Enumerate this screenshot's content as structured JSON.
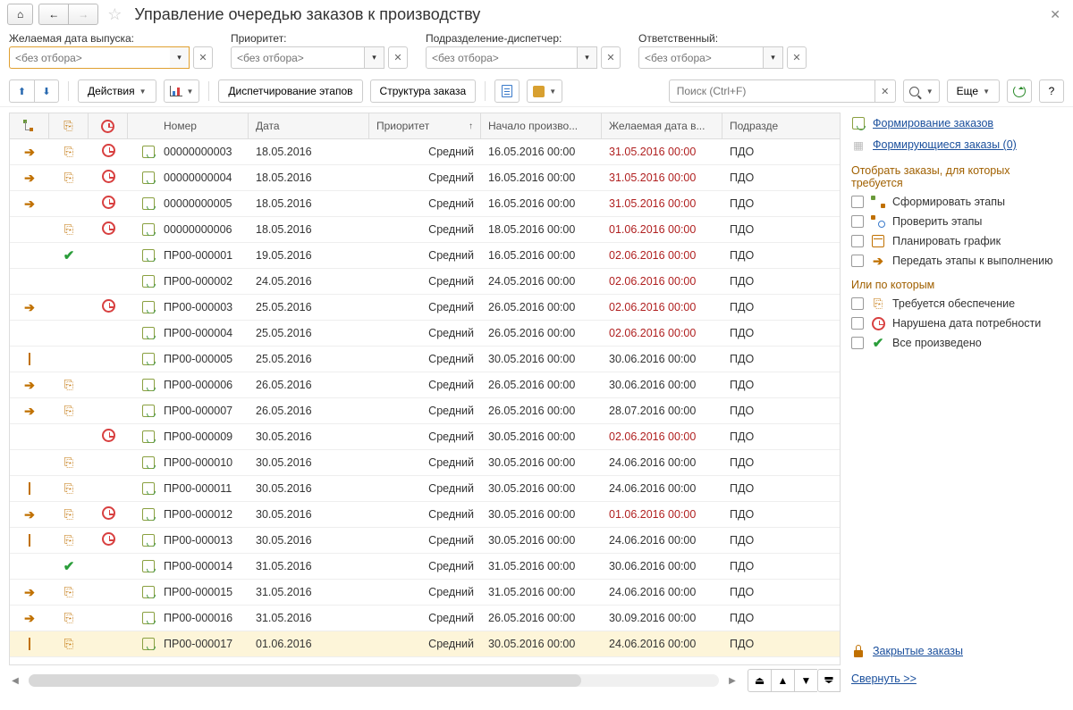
{
  "title": "Управление очередью заказов к производству",
  "filters": {
    "release_date": {
      "label": "Желаемая дата выпуска:",
      "placeholder": "<без отбора>"
    },
    "priority": {
      "label": "Приоритет:",
      "placeholder": "<без отбора>"
    },
    "dispatcher": {
      "label": "Подразделение-диспетчер:",
      "placeholder": "<без отбора>"
    },
    "responsible": {
      "label": "Ответственный:",
      "placeholder": "<без отбора>"
    }
  },
  "toolbar": {
    "actions": "Действия",
    "dispatching": "Диспетчирование этапов",
    "structure": "Структура заказа",
    "search_placeholder": "Поиск (Ctrl+F)",
    "more": "Еще"
  },
  "columns": {
    "number": "Номер",
    "date": "Дата",
    "priority": "Приоритет",
    "sort_arrow": "↑",
    "start": "Начало произво...",
    "want": "Желаемая дата в...",
    "dept": "Подразде"
  },
  "rows": [
    {
      "ic1": "arrow",
      "ic2": "box",
      "ic3": "clock",
      "number": "00000000003",
      "date": "18.05.2016",
      "priority": "Средний",
      "start": "16.05.2016 00:00",
      "want": "31.05.2016 00:00",
      "red": true,
      "dept": "ПДО"
    },
    {
      "ic1": "arrow",
      "ic2": "box",
      "ic3": "clock",
      "number": "00000000004",
      "date": "18.05.2016",
      "priority": "Средний",
      "start": "16.05.2016 00:00",
      "want": "31.05.2016 00:00",
      "red": true,
      "dept": "ПДО"
    },
    {
      "ic1": "arrow",
      "ic2": "",
      "ic3": "clock",
      "number": "00000000005",
      "date": "18.05.2016",
      "priority": "Средний",
      "start": "16.05.2016 00:00",
      "want": "31.05.2016 00:00",
      "red": true,
      "dept": "ПДО"
    },
    {
      "ic1": "tree",
      "ic2": "box",
      "ic3": "clock",
      "number": "00000000006",
      "date": "18.05.2016",
      "priority": "Средний",
      "start": "18.05.2016 00:00",
      "want": "01.06.2016 00:00",
      "red": true,
      "dept": "ПДО"
    },
    {
      "ic1": "",
      "ic2": "check",
      "ic3": "",
      "number": "ПР00-000001",
      "date": "19.05.2016",
      "priority": "Средний",
      "start": "16.05.2016 00:00",
      "want": "02.06.2016 00:00",
      "red": true,
      "dept": "ПДО"
    },
    {
      "ic1": "",
      "ic2": "",
      "ic3": "",
      "number": "ПР00-000002",
      "date": "24.05.2016",
      "priority": "Средний",
      "start": "24.05.2016 00:00",
      "want": "02.06.2016 00:00",
      "red": true,
      "dept": "ПДО"
    },
    {
      "ic1": "arrow",
      "ic2": "",
      "ic3": "clock",
      "number": "ПР00-000003",
      "date": "25.05.2016",
      "priority": "Средний",
      "start": "26.05.2016 00:00",
      "want": "02.06.2016 00:00",
      "red": true,
      "dept": "ПДО"
    },
    {
      "ic1": "",
      "ic2": "",
      "ic3": "",
      "number": "ПР00-000004",
      "date": "25.05.2016",
      "priority": "Средний",
      "start": "26.05.2016 00:00",
      "want": "02.06.2016 00:00",
      "red": true,
      "dept": "ПДО"
    },
    {
      "ic1": "cal",
      "ic2": "",
      "ic3": "",
      "number": "ПР00-000005",
      "date": "25.05.2016",
      "priority": "Средний",
      "start": "30.05.2016 00:00",
      "want": "30.06.2016 00:00",
      "red": false,
      "dept": "ПДО"
    },
    {
      "ic1": "arrow",
      "ic2": "box",
      "ic3": "",
      "number": "ПР00-000006",
      "date": "26.05.2016",
      "priority": "Средний",
      "start": "26.05.2016 00:00",
      "want": "30.06.2016 00:00",
      "red": false,
      "dept": "ПДО"
    },
    {
      "ic1": "arrow",
      "ic2": "box",
      "ic3": "",
      "number": "ПР00-000007",
      "date": "26.05.2016",
      "priority": "Средний",
      "start": "26.05.2016 00:00",
      "want": "28.07.2016 00:00",
      "red": false,
      "dept": "ПДО"
    },
    {
      "ic1": "",
      "ic2": "",
      "ic3": "clock",
      "number": "ПР00-000009",
      "date": "30.05.2016",
      "priority": "Средний",
      "start": "30.05.2016 00:00",
      "want": "02.06.2016 00:00",
      "red": true,
      "dept": "ПДО"
    },
    {
      "ic1": "treecal",
      "ic2": "box",
      "ic3": "",
      "number": "ПР00-000010",
      "date": "30.05.2016",
      "priority": "Средний",
      "start": "30.05.2016 00:00",
      "want": "24.06.2016 00:00",
      "red": false,
      "dept": "ПДО"
    },
    {
      "ic1": "cal",
      "ic2": "box",
      "ic3": "",
      "number": "ПР00-000011",
      "date": "30.05.2016",
      "priority": "Средний",
      "start": "30.05.2016 00:00",
      "want": "24.06.2016 00:00",
      "red": false,
      "dept": "ПДО"
    },
    {
      "ic1": "arrow",
      "ic2": "box",
      "ic3": "clock",
      "number": "ПР00-000012",
      "date": "30.05.2016",
      "priority": "Средний",
      "start": "30.05.2016 00:00",
      "want": "01.06.2016 00:00",
      "red": true,
      "dept": "ПДО"
    },
    {
      "ic1": "cal",
      "ic2": "box",
      "ic3": "clock",
      "number": "ПР00-000013",
      "date": "30.05.2016",
      "priority": "Средний",
      "start": "30.05.2016 00:00",
      "want": "24.06.2016 00:00",
      "red": false,
      "dept": "ПДО"
    },
    {
      "ic1": "",
      "ic2": "check",
      "ic3": "",
      "number": "ПР00-000014",
      "date": "31.05.2016",
      "priority": "Средний",
      "start": "31.05.2016 00:00",
      "want": "30.06.2016 00:00",
      "red": false,
      "dept": "ПДО"
    },
    {
      "ic1": "arrow",
      "ic2": "box",
      "ic3": "",
      "number": "ПР00-000015",
      "date": "31.05.2016",
      "priority": "Средний",
      "start": "31.05.2016 00:00",
      "want": "24.06.2016 00:00",
      "red": false,
      "dept": "ПДО"
    },
    {
      "ic1": "arrow",
      "ic2": "box",
      "ic3": "",
      "number": "ПР00-000016",
      "date": "31.05.2016",
      "priority": "Средний",
      "start": "26.05.2016 00:00",
      "want": "30.09.2016 00:00",
      "red": false,
      "dept": "ПДО"
    },
    {
      "ic1": "cal",
      "ic2": "box",
      "ic3": "",
      "number": "ПР00-000017",
      "date": "01.06.2016",
      "priority": "Средний",
      "start": "30.05.2016 00:00",
      "want": "24.06.2016 00:00",
      "red": false,
      "dept": "ПДО",
      "sel": true
    }
  ],
  "side": {
    "link_forming": "Формирование заказов",
    "link_queue": "Формирующиеся заказы (0)",
    "header1": "Отобрать заказы, для которых требуется",
    "f_stages": "Сформировать этапы",
    "f_check": "Проверить этапы",
    "f_plan": "Планировать график",
    "f_transfer": "Передать этапы к выполнению",
    "header2": "Или по которым",
    "f_supply": "Требуется обеспечение",
    "f_overdue": "Нарушена дата потребности",
    "f_done": "Все произведено",
    "closed": "Закрытые заказы",
    "collapse": "Свернуть >>"
  }
}
